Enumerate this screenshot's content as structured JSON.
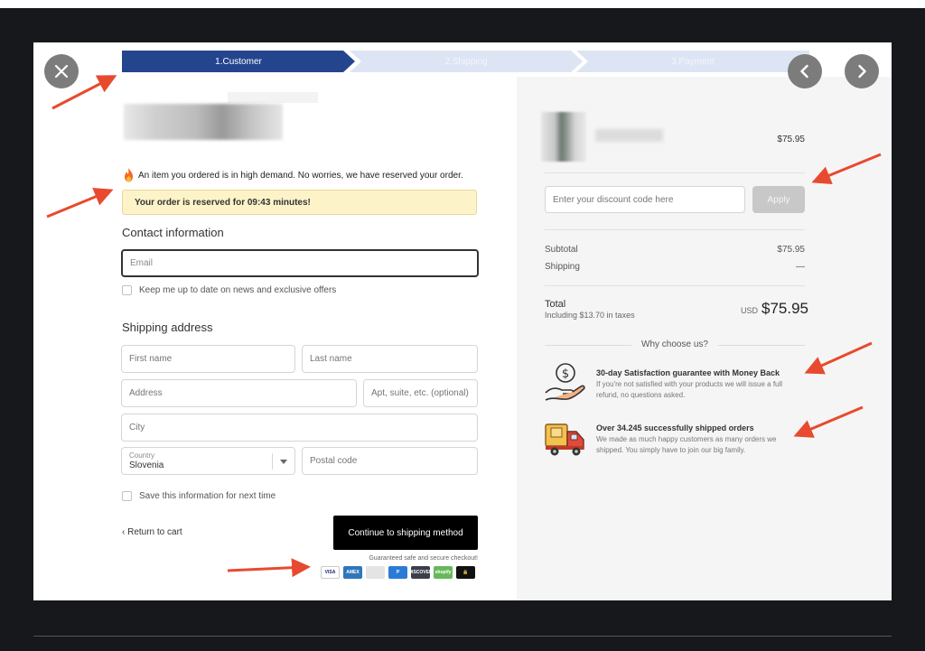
{
  "steps": [
    {
      "label": "1.Customer"
    },
    {
      "label": "2.Shipping"
    },
    {
      "label": "3.Payment"
    }
  ],
  "notice": {
    "demand_text": "An item you ordered is in high demand. No worries, we have reserved your order.",
    "reserve_text": "Your order is reserved for 09:43 minutes!"
  },
  "contact": {
    "title": "Contact information",
    "email_placeholder": "Email",
    "newsletter_label": "Keep me up to date on news and exclusive offers"
  },
  "shipping": {
    "title": "Shipping address",
    "first_name_placeholder": "First name",
    "last_name_placeholder": "Last name",
    "address_placeholder": "Address",
    "apt_placeholder": "Apt, suite, etc. (optional)",
    "city_placeholder": "City",
    "country_label": "Country",
    "country_value": "Slovenia",
    "postal_placeholder": "Postal code",
    "save_info_label": "Save this information for next time"
  },
  "actions": {
    "return_label": "‹ Return to cart",
    "continue_label": "Continue to shipping method",
    "secure_text": "Guaranteed safe and secure checkout!"
  },
  "payment_icons": [
    {
      "name": "visa",
      "label": "VISA",
      "color": "#ffffff",
      "text_color": "#1a1f71"
    },
    {
      "name": "amex",
      "label": "AMEX",
      "color": "#2e77bb",
      "text_color": "#ffffff"
    },
    {
      "name": "card",
      "label": "",
      "color": "#e4e4e4",
      "text_color": "#333333"
    },
    {
      "name": "paypal",
      "label": "P",
      "color": "#2b7bd6",
      "text_color": "#ffffff"
    },
    {
      "name": "discover",
      "label": "DISCOVER",
      "color": "#3a3f4a",
      "text_color": "#ffffff"
    },
    {
      "name": "shopify",
      "label": "shopify",
      "color": "#66b85a",
      "text_color": "#ffffff"
    },
    {
      "name": "lock",
      "label": "🔒",
      "color": "#111111",
      "text_color": "#ffffff"
    }
  ],
  "summary": {
    "item_price": "$75.95",
    "discount_placeholder": "Enter your discount code here",
    "apply_label": "Apply",
    "subtotal_label": "Subtotal",
    "subtotal_value": "$75.95",
    "shipping_label": "Shipping",
    "shipping_value": "—",
    "total_label": "Total",
    "tax_text": "Including $13.70 in taxes",
    "currency": "USD",
    "total_value": "$75.95"
  },
  "why": {
    "title": "Why choose us?",
    "features": [
      {
        "title": "30-day Satisfaction guarantee with Money Back",
        "desc": "If you're not satisfied with your products we will issue a full refund, no questions asked.",
        "icon": "money-back-icon"
      },
      {
        "title": "Over 34.245 successfully shipped orders",
        "desc": "We made as much happy customers as many orders we shipped. You simply have to join our big family.",
        "icon": "delivery-truck-icon"
      }
    ]
  },
  "colors": {
    "step_active": "#24458e",
    "step_inactive": "#dde4f3",
    "reserve_bg": "#fdf3c8",
    "annotation_arrow": "#e84a2f",
    "continue_bg": "#000000"
  }
}
